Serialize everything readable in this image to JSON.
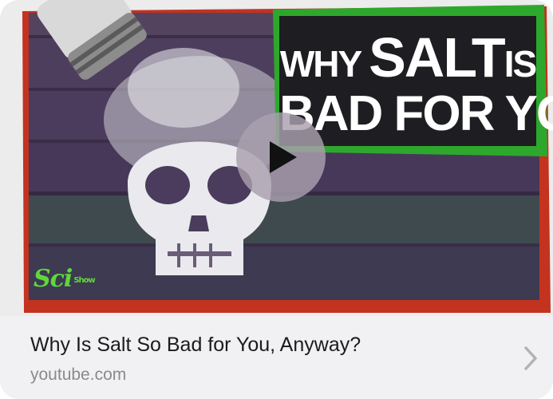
{
  "link_preview": {
    "thumbnail": {
      "headline_line1_a": "WHY ",
      "headline_line1_b": "SALT",
      "headline_line1_c": "IS",
      "headline_line2": "BAD FOR YOU",
      "channel_logo": "Sci",
      "channel_logo_small": "Show",
      "accent_colors": {
        "green": "#2ea82c",
        "red": "#c3331f",
        "wood": "#4a3a5a"
      }
    },
    "play_icon": "play-icon",
    "title": "Why Is Salt So Bad for You, Anyway?",
    "domain": "youtube.com",
    "chevron_icon": "chevron-right-icon"
  }
}
